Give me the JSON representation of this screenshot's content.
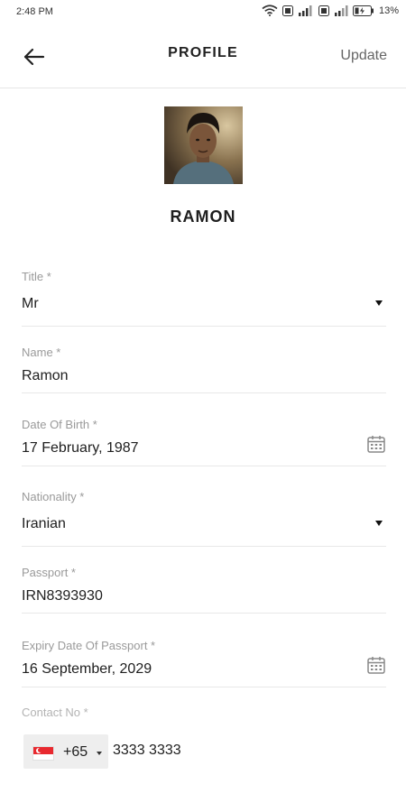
{
  "status_bar": {
    "time": "2:48 PM",
    "battery": "13%",
    "icons": [
      "wifi-icon",
      "volte-icon",
      "signal-icon",
      "volte-icon",
      "signal-icon",
      "battery-icon"
    ]
  },
  "header": {
    "back_icon": "arrow-left-icon",
    "title": "PROFILE",
    "update_label": "Update"
  },
  "profile": {
    "name": "RAMON"
  },
  "form": {
    "title": {
      "label": "Title *",
      "value": "Mr"
    },
    "name": {
      "label": "Name *",
      "value": "Ramon"
    },
    "dob": {
      "label": "Date Of Birth *",
      "value": "17 February, 1987"
    },
    "nationality": {
      "label": "Nationality *",
      "value": "Iranian"
    },
    "passport": {
      "label": "Passport *",
      "value": "IRN8393930"
    },
    "passport_expiry": {
      "label": "Expiry Date Of Passport *",
      "value": "16 September, 2029"
    },
    "contact": {
      "label": "Contact No *",
      "dial_code": "+65",
      "number": "3333 3333",
      "flag": "singapore-flag-icon"
    }
  },
  "colors": {
    "accent_text": "#202020",
    "label_text": "#9a9a9a",
    "divider": "#e8e8e8",
    "flag_red": "#e8292f"
  }
}
